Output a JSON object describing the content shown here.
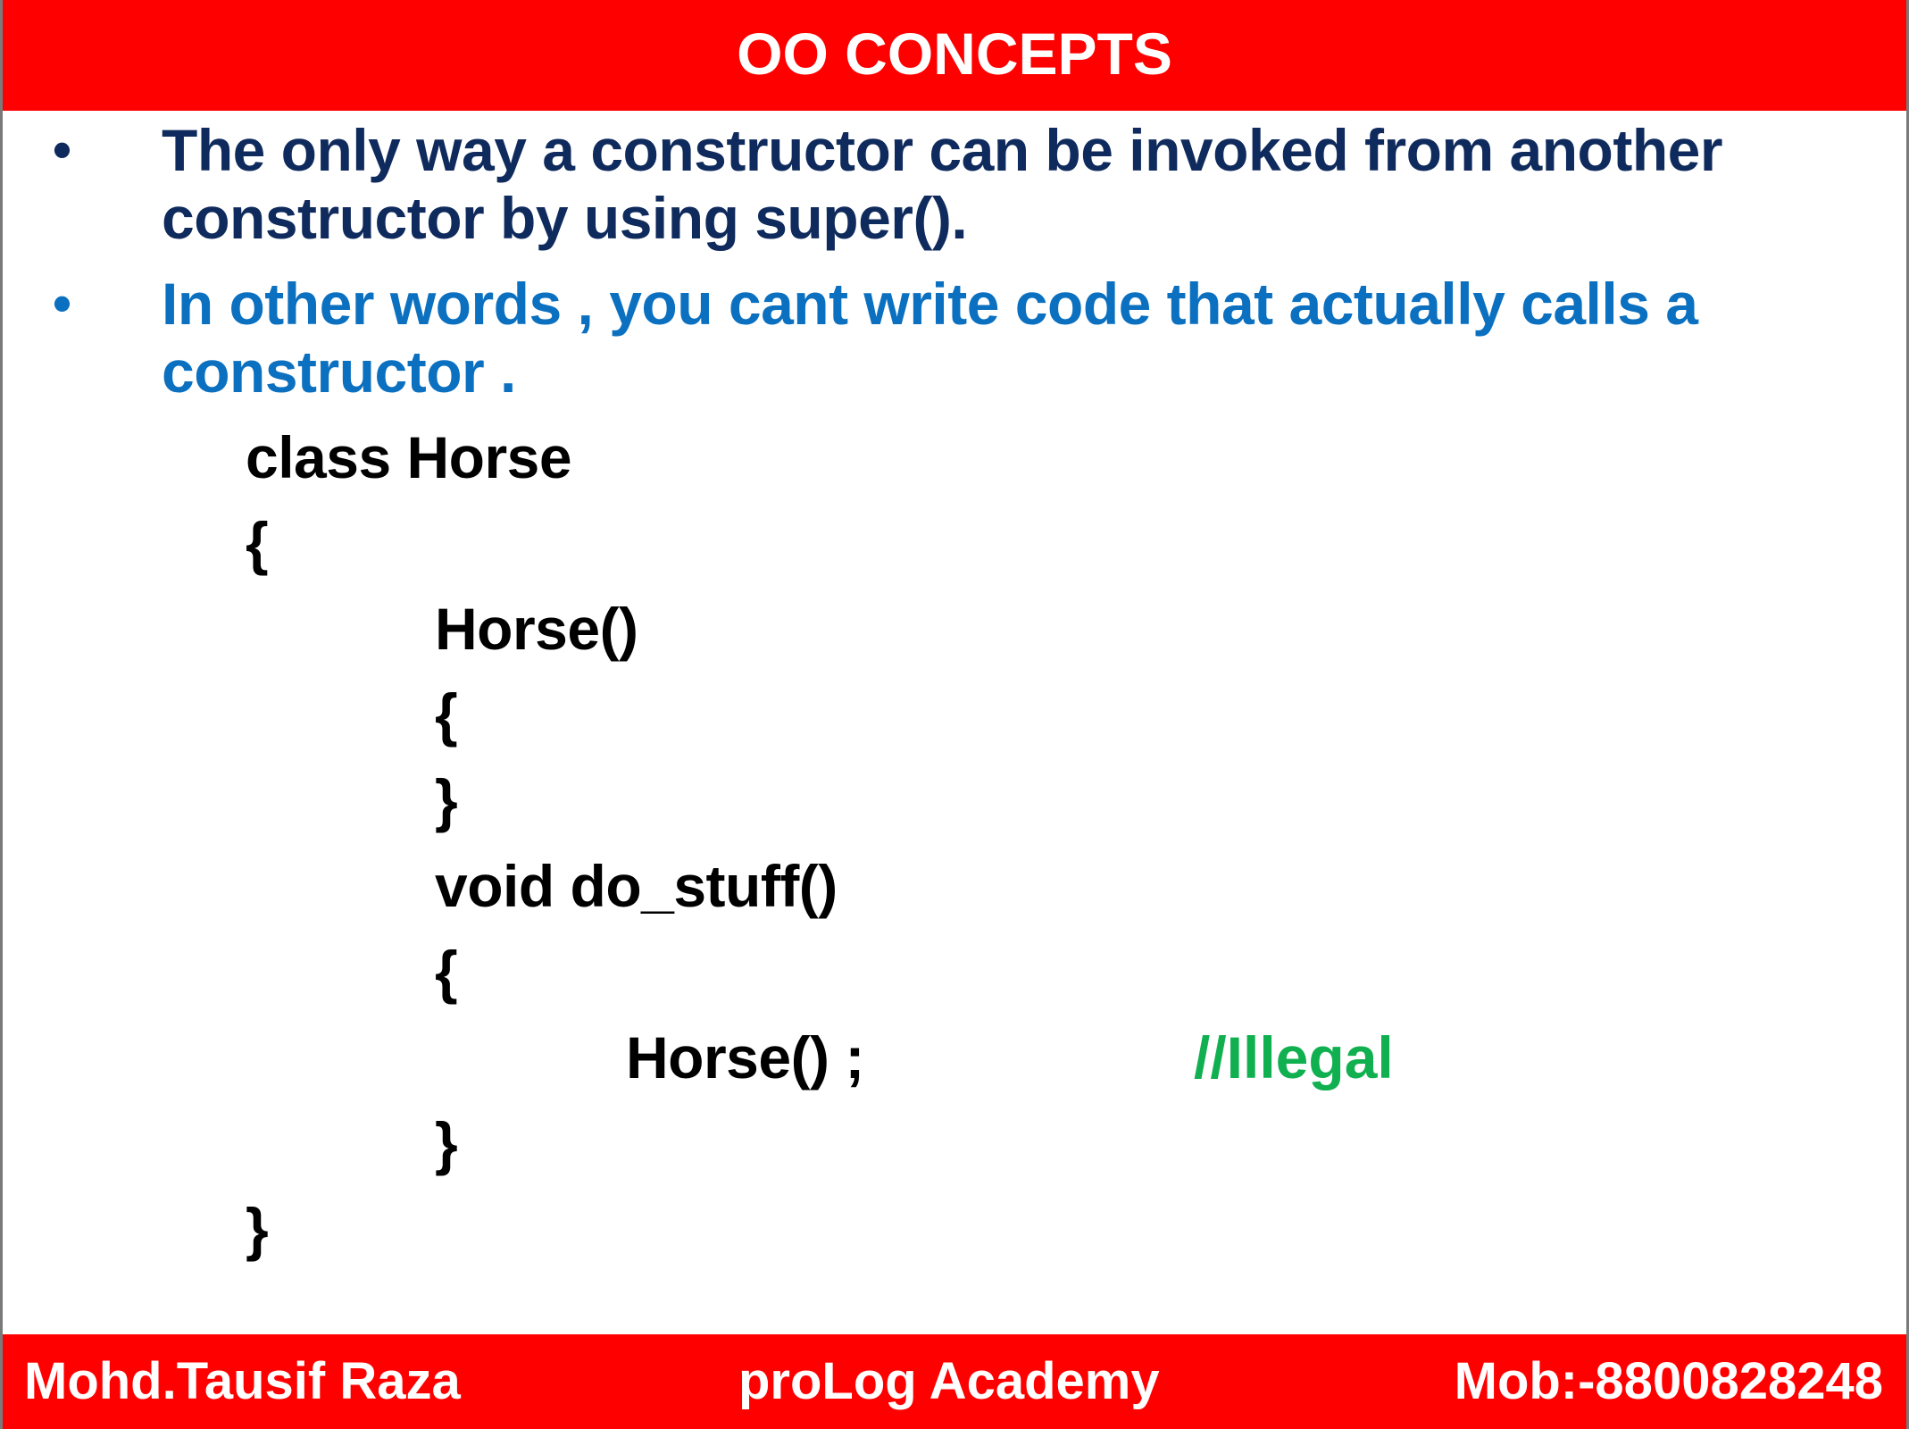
{
  "title": "OO CONCEPTS",
  "bullets": [
    {
      "marker": "•",
      "text": "The only way a constructor can be invoked from another constructor by using super()."
    },
    {
      "marker": "•",
      "text": "In other words , you cant write code that actually calls a constructor ."
    }
  ],
  "code": {
    "line1": "class Horse",
    "line2": "{",
    "line3": "Horse()",
    "line4": "{",
    "line5": "}",
    "line6": "void do_stuff()",
    "line7": "{",
    "line8": "Horse() ;",
    "line9": "}",
    "line10": "}",
    "comment": "//Illegal"
  },
  "footer": {
    "left": "Mohd.Tausif Raza",
    "center": "proLog Academy",
    "right": "Mob:-8800828248"
  },
  "colors": {
    "header_bg": "#ff0000",
    "bullet1": "#0f2a5c",
    "bullet2": "#0b70c0",
    "comment": "#10b050"
  }
}
